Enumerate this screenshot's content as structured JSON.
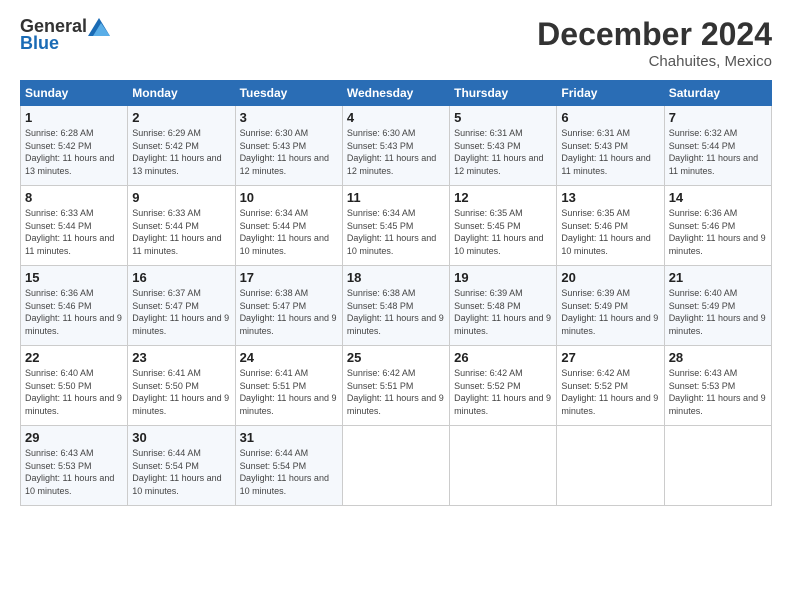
{
  "header": {
    "logo_general": "General",
    "logo_blue": "Blue",
    "title": "December 2024",
    "location": "Chahuites, Mexico"
  },
  "days_of_week": [
    "Sunday",
    "Monday",
    "Tuesday",
    "Wednesday",
    "Thursday",
    "Friday",
    "Saturday"
  ],
  "weeks": [
    [
      {
        "day": 1,
        "sunrise": "6:28 AM",
        "sunset": "5:42 PM",
        "daylight": "11 hours and 13 minutes."
      },
      {
        "day": 2,
        "sunrise": "6:29 AM",
        "sunset": "5:42 PM",
        "daylight": "11 hours and 13 minutes."
      },
      {
        "day": 3,
        "sunrise": "6:30 AM",
        "sunset": "5:43 PM",
        "daylight": "11 hours and 12 minutes."
      },
      {
        "day": 4,
        "sunrise": "6:30 AM",
        "sunset": "5:43 PM",
        "daylight": "11 hours and 12 minutes."
      },
      {
        "day": 5,
        "sunrise": "6:31 AM",
        "sunset": "5:43 PM",
        "daylight": "11 hours and 12 minutes."
      },
      {
        "day": 6,
        "sunrise": "6:31 AM",
        "sunset": "5:43 PM",
        "daylight": "11 hours and 11 minutes."
      },
      {
        "day": 7,
        "sunrise": "6:32 AM",
        "sunset": "5:44 PM",
        "daylight": "11 hours and 11 minutes."
      }
    ],
    [
      {
        "day": 8,
        "sunrise": "6:33 AM",
        "sunset": "5:44 PM",
        "daylight": "11 hours and 11 minutes."
      },
      {
        "day": 9,
        "sunrise": "6:33 AM",
        "sunset": "5:44 PM",
        "daylight": "11 hours and 11 minutes."
      },
      {
        "day": 10,
        "sunrise": "6:34 AM",
        "sunset": "5:44 PM",
        "daylight": "11 hours and 10 minutes."
      },
      {
        "day": 11,
        "sunrise": "6:34 AM",
        "sunset": "5:45 PM",
        "daylight": "11 hours and 10 minutes."
      },
      {
        "day": 12,
        "sunrise": "6:35 AM",
        "sunset": "5:45 PM",
        "daylight": "11 hours and 10 minutes."
      },
      {
        "day": 13,
        "sunrise": "6:35 AM",
        "sunset": "5:46 PM",
        "daylight": "11 hours and 10 minutes."
      },
      {
        "day": 14,
        "sunrise": "6:36 AM",
        "sunset": "5:46 PM",
        "daylight": "11 hours and 9 minutes."
      }
    ],
    [
      {
        "day": 15,
        "sunrise": "6:36 AM",
        "sunset": "5:46 PM",
        "daylight": "11 hours and 9 minutes."
      },
      {
        "day": 16,
        "sunrise": "6:37 AM",
        "sunset": "5:47 PM",
        "daylight": "11 hours and 9 minutes."
      },
      {
        "day": 17,
        "sunrise": "6:38 AM",
        "sunset": "5:47 PM",
        "daylight": "11 hours and 9 minutes."
      },
      {
        "day": 18,
        "sunrise": "6:38 AM",
        "sunset": "5:48 PM",
        "daylight": "11 hours and 9 minutes."
      },
      {
        "day": 19,
        "sunrise": "6:39 AM",
        "sunset": "5:48 PM",
        "daylight": "11 hours and 9 minutes."
      },
      {
        "day": 20,
        "sunrise": "6:39 AM",
        "sunset": "5:49 PM",
        "daylight": "11 hours and 9 minutes."
      },
      {
        "day": 21,
        "sunrise": "6:40 AM",
        "sunset": "5:49 PM",
        "daylight": "11 hours and 9 minutes."
      }
    ],
    [
      {
        "day": 22,
        "sunrise": "6:40 AM",
        "sunset": "5:50 PM",
        "daylight": "11 hours and 9 minutes."
      },
      {
        "day": 23,
        "sunrise": "6:41 AM",
        "sunset": "5:50 PM",
        "daylight": "11 hours and 9 minutes."
      },
      {
        "day": 24,
        "sunrise": "6:41 AM",
        "sunset": "5:51 PM",
        "daylight": "11 hours and 9 minutes."
      },
      {
        "day": 25,
        "sunrise": "6:42 AM",
        "sunset": "5:51 PM",
        "daylight": "11 hours and 9 minutes."
      },
      {
        "day": 26,
        "sunrise": "6:42 AM",
        "sunset": "5:52 PM",
        "daylight": "11 hours and 9 minutes."
      },
      {
        "day": 27,
        "sunrise": "6:42 AM",
        "sunset": "5:52 PM",
        "daylight": "11 hours and 9 minutes."
      },
      {
        "day": 28,
        "sunrise": "6:43 AM",
        "sunset": "5:53 PM",
        "daylight": "11 hours and 9 minutes."
      }
    ],
    [
      {
        "day": 29,
        "sunrise": "6:43 AM",
        "sunset": "5:53 PM",
        "daylight": "11 hours and 10 minutes."
      },
      {
        "day": 30,
        "sunrise": "6:44 AM",
        "sunset": "5:54 PM",
        "daylight": "11 hours and 10 minutes."
      },
      {
        "day": 31,
        "sunrise": "6:44 AM",
        "sunset": "5:54 PM",
        "daylight": "11 hours and 10 minutes."
      },
      null,
      null,
      null,
      null
    ]
  ]
}
